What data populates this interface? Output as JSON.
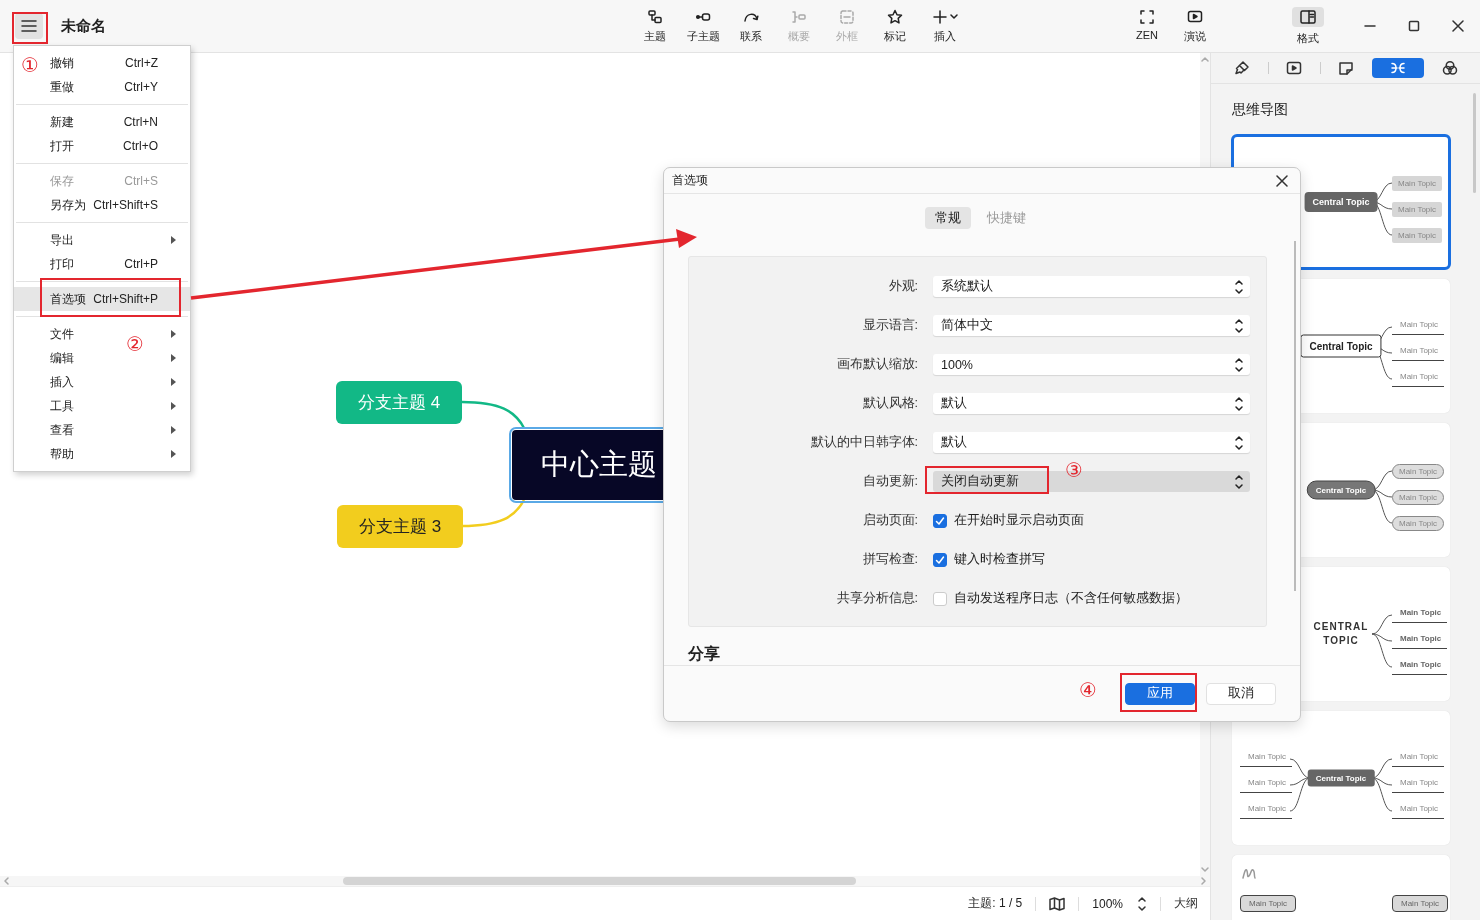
{
  "window": {
    "title": "未命名"
  },
  "toolbar": [
    {
      "kind": "topic",
      "label": "主题",
      "disabled": false,
      "has_menu": false
    },
    {
      "kind": "subtopic",
      "label": "子主题",
      "disabled": false,
      "has_menu": false
    },
    {
      "kind": "relation",
      "label": "联系",
      "disabled": false,
      "has_menu": false
    },
    {
      "kind": "summary",
      "label": "概要",
      "disabled": true,
      "has_menu": false
    },
    {
      "kind": "boundary",
      "label": "外框",
      "disabled": true,
      "has_menu": false
    },
    {
      "kind": "marker",
      "label": "标记",
      "disabled": false,
      "has_menu": false
    },
    {
      "kind": "insert",
      "label": "插入",
      "disabled": false,
      "has_menu": true
    }
  ],
  "view_buttons": [
    {
      "kind": "zen",
      "label": "ZEN"
    },
    {
      "kind": "present",
      "label": "演说"
    }
  ],
  "format_button": {
    "label": "格式",
    "selected": true
  },
  "menu": {
    "groups": [
      [
        {
          "label": "撤销",
          "shortcut": "Ctrl+Z",
          "disabled": false,
          "submenu": false,
          "highlighted": false
        },
        {
          "label": "重做",
          "shortcut": "Ctrl+Y",
          "disabled": false,
          "submenu": false,
          "highlighted": false
        }
      ],
      [
        {
          "label": "新建",
          "shortcut": "Ctrl+N",
          "disabled": false,
          "submenu": false,
          "highlighted": false
        },
        {
          "label": "打开",
          "shortcut": "Ctrl+O",
          "disabled": false,
          "submenu": false,
          "highlighted": false
        }
      ],
      [
        {
          "label": "保存",
          "shortcut": "Ctrl+S",
          "disabled": true,
          "submenu": false,
          "highlighted": false
        },
        {
          "label": "另存为",
          "shortcut": "Ctrl+Shift+S",
          "disabled": false,
          "submenu": false,
          "highlighted": false
        }
      ],
      [
        {
          "label": "导出",
          "disabled": false,
          "submenu": true,
          "highlighted": false
        },
        {
          "label": "打印",
          "shortcut": "Ctrl+P",
          "disabled": false,
          "submenu": false,
          "highlighted": false
        }
      ],
      [
        {
          "label": "首选项",
          "shortcut": "Ctrl+Shift+P",
          "disabled": false,
          "submenu": false,
          "highlighted": true
        }
      ],
      [
        {
          "label": "文件",
          "disabled": false,
          "submenu": true,
          "highlighted": false
        },
        {
          "label": "编辑",
          "disabled": false,
          "submenu": true,
          "highlighted": false
        },
        {
          "label": "插入",
          "disabled": false,
          "submenu": true,
          "highlighted": false
        },
        {
          "label": "工具",
          "disabled": false,
          "submenu": true,
          "highlighted": false
        },
        {
          "label": "查看",
          "disabled": false,
          "submenu": true,
          "highlighted": false
        },
        {
          "label": "帮助",
          "disabled": false,
          "submenu": true,
          "highlighted": false
        }
      ]
    ]
  },
  "mind_map": {
    "central": {
      "text": "中心主题",
      "selected": true
    },
    "branches": [
      {
        "text": "分支主题 4",
        "color": "#12b886"
      },
      {
        "text": "分支主题 3",
        "color": "#f2cd1e"
      }
    ]
  },
  "dialog": {
    "title": "首选项",
    "tabs": [
      {
        "label": "常规",
        "selected": true
      },
      {
        "label": "快捷键",
        "selected": false
      }
    ],
    "settings": [
      {
        "kind": "select",
        "label": "外观:",
        "value": "系统默认",
        "disabled": false
      },
      {
        "kind": "select",
        "label": "显示语言:",
        "value": "简体中文",
        "disabled": false
      },
      {
        "kind": "select",
        "label": "画布默认缩放:",
        "value": "100%",
        "disabled": false
      },
      {
        "kind": "select",
        "label": "默认风格:",
        "value": "默认",
        "disabled": false
      },
      {
        "kind": "select",
        "label": "默认的中日韩字体:",
        "value": "默认",
        "disabled": false
      },
      {
        "kind": "select",
        "label": "自动更新:",
        "value": "关闭自动更新",
        "disabled": true
      },
      {
        "kind": "checkbox",
        "label": "启动页面:",
        "text": "在开始时显示启动页面",
        "checked": true
      },
      {
        "kind": "checkbox",
        "label": "拼写检查:",
        "text": "键入时检查拼写",
        "checked": true
      },
      {
        "kind": "checkbox",
        "label": "共享分析信息:",
        "text": "自动发送程序日志（不含任何敏感数据）",
        "checked": false
      }
    ],
    "section": "分享",
    "buttons": [
      {
        "label": "应用",
        "primary": true
      },
      {
        "label": "取消",
        "primary": false
      }
    ]
  },
  "format_panel": {
    "tabs": [
      {
        "kind": "brush",
        "selected": false
      },
      {
        "kind": "present",
        "selected": false
      },
      {
        "kind": "sticky",
        "selected": false
      },
      {
        "kind": "structure",
        "selected": true
      },
      {
        "kind": "palette",
        "selected": false
      }
    ],
    "title": "思维导图",
    "themes": [
      {
        "kind": "filled",
        "selected": true,
        "central": "Central Topic",
        "right_topics": [
          "Main Topic",
          "Main Topic",
          "Main Topic"
        ]
      },
      {
        "kind": "outline",
        "selected": false,
        "central": "Central Topic",
        "right_topics": [
          "Main Topic",
          "Main Topic",
          "Main Topic"
        ]
      },
      {
        "kind": "rounded",
        "selected": false,
        "central": "Central Topic",
        "right_topics": [
          "Main Topic",
          "Main Topic",
          "Main Topic"
        ]
      },
      {
        "kind": "plain",
        "selected": false,
        "central": "CENTRAL TOPIC",
        "right_topics": [
          "Main Topic",
          "Main Topic",
          "Main Topic"
        ]
      },
      {
        "kind": "lined",
        "selected": false,
        "central": "Central Topic",
        "left_topics": [
          "Main Topic",
          "Main Topic",
          "Main Topic"
        ],
        "right_topics": [
          "Main Topic",
          "Main Topic",
          "Main Topic"
        ]
      },
      {
        "kind": "sketch",
        "selected": false,
        "left_topics": [
          "Main Topic"
        ],
        "right_topics": [
          "Main Topic"
        ]
      }
    ]
  },
  "status_bar": {
    "topic_count": "主题: 1 / 5",
    "zoom": "100%",
    "outline": "大纲"
  },
  "annotations": [
    "①",
    "②",
    "③",
    "④"
  ]
}
